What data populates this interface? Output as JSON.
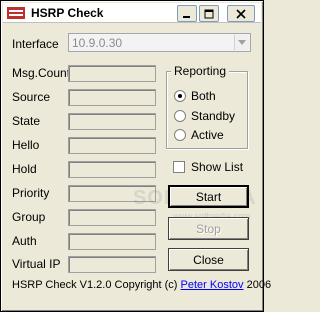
{
  "window": {
    "title": "HSRP Check"
  },
  "interface": {
    "label": "Interface",
    "value": "10.9.0.30"
  },
  "fields": [
    {
      "label": "Msg.Count",
      "value": ""
    },
    {
      "label": "Source",
      "value": ""
    },
    {
      "label": "State",
      "value": ""
    },
    {
      "label": "Hello",
      "value": ""
    },
    {
      "label": "Hold",
      "value": ""
    },
    {
      "label": "Priority",
      "value": ""
    },
    {
      "label": "Group",
      "value": ""
    },
    {
      "label": "Auth",
      "value": ""
    },
    {
      "label": "Virtual IP",
      "value": ""
    }
  ],
  "reporting": {
    "title": "Reporting",
    "options": [
      "Both",
      "Standby",
      "Active"
    ],
    "selected": "Both"
  },
  "show_list": {
    "label": "Show List",
    "checked": false
  },
  "buttons": {
    "start": "Start",
    "stop": "Stop",
    "close": "Close"
  },
  "footer": {
    "text": "HSRP Check V1.2.0 Copyright (c)",
    "author": "Peter Kostov",
    "year": "2006"
  },
  "watermark": {
    "main": "SOFTPEDIA",
    "sub": "www.softpedia.com"
  }
}
